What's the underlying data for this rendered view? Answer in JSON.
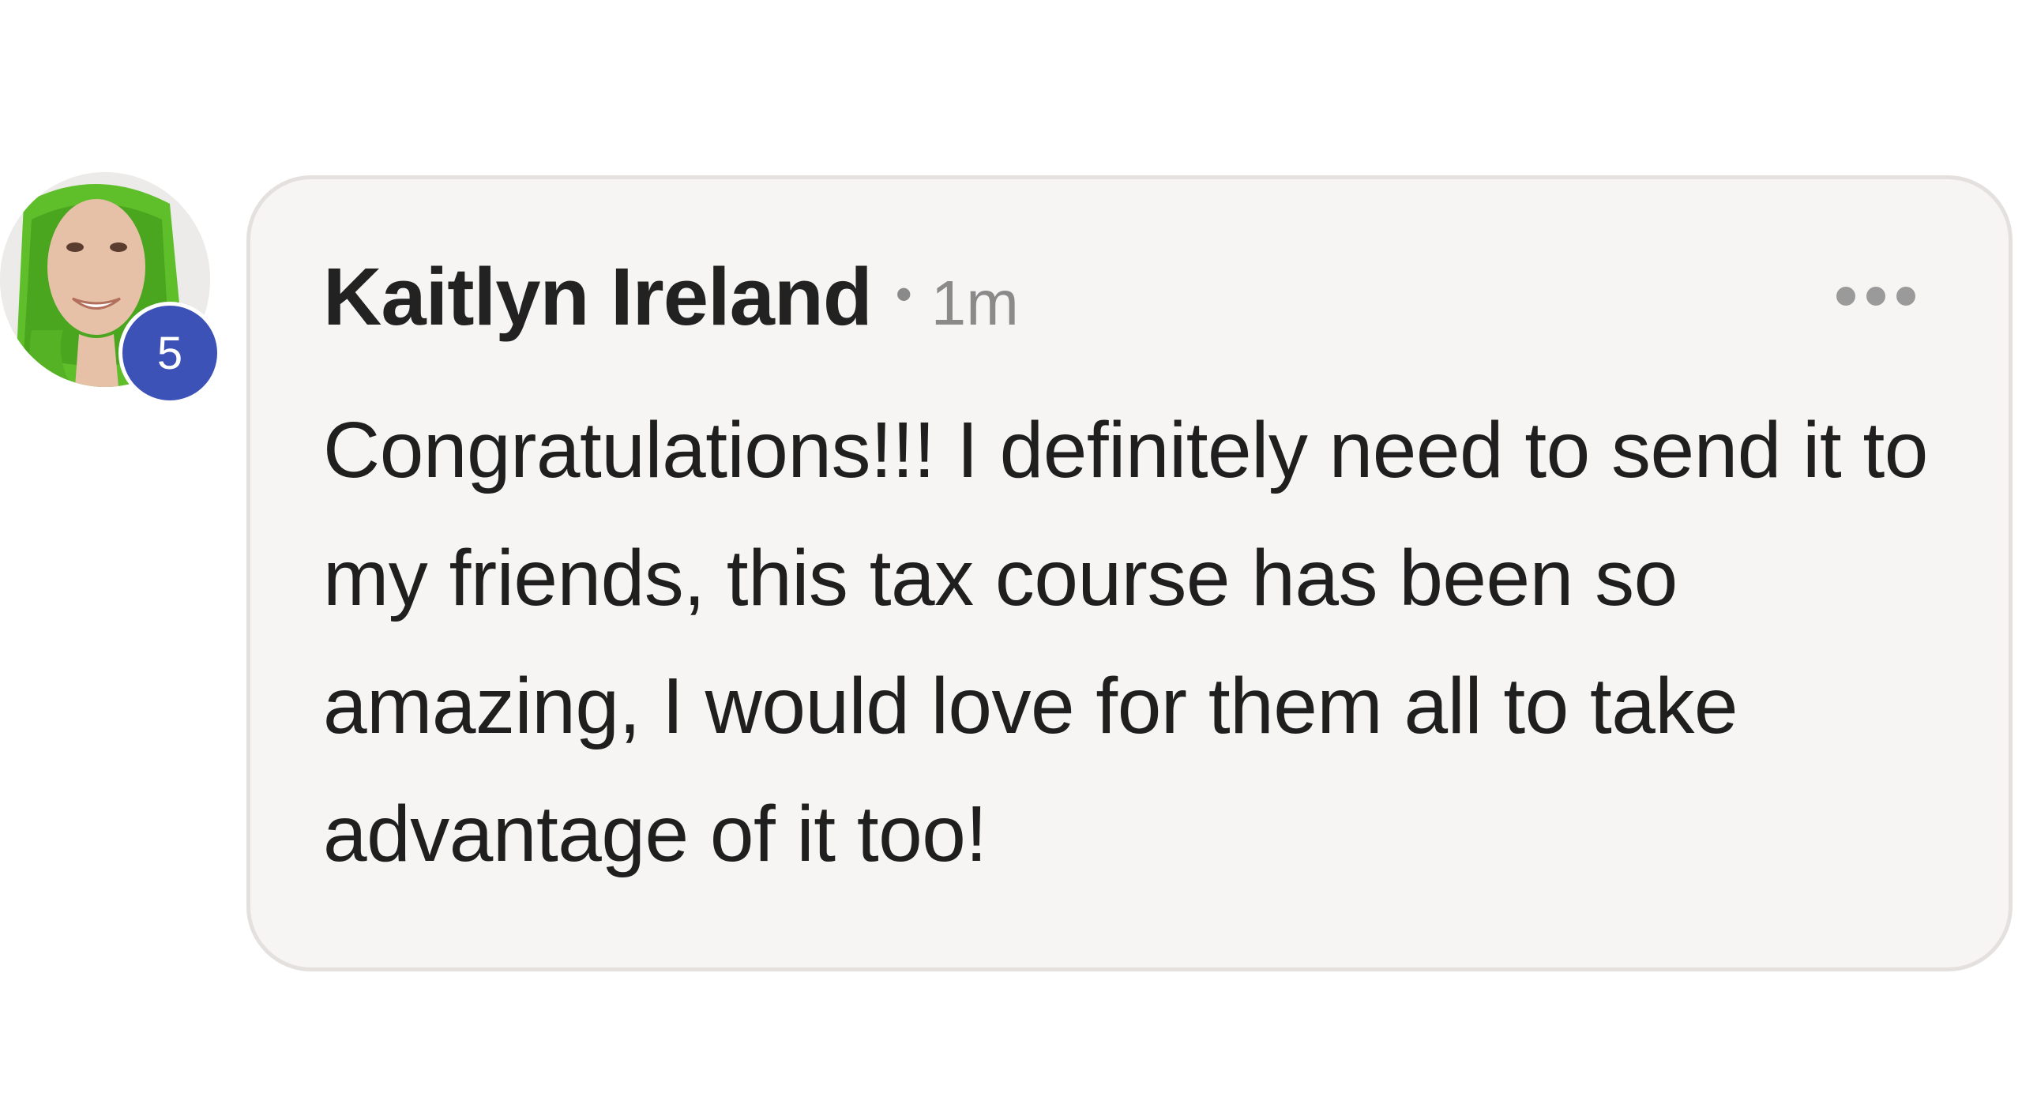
{
  "comment": {
    "author": "Kaitlyn Ireland",
    "separator": "•",
    "timestamp": "1m",
    "level": "5",
    "text": "Congratulations!!! I definitely need to send it to my friends, this tax course has been so amazing, I would love for them all to take advantage of it too!",
    "more_icon": "more-horizontal-icon",
    "colors": {
      "badge": "#3d52b7",
      "bubble": "#f7f5f4",
      "bubble_border": "#e3e0de",
      "author": "#222222",
      "timestamp": "#8a8a8a"
    }
  }
}
